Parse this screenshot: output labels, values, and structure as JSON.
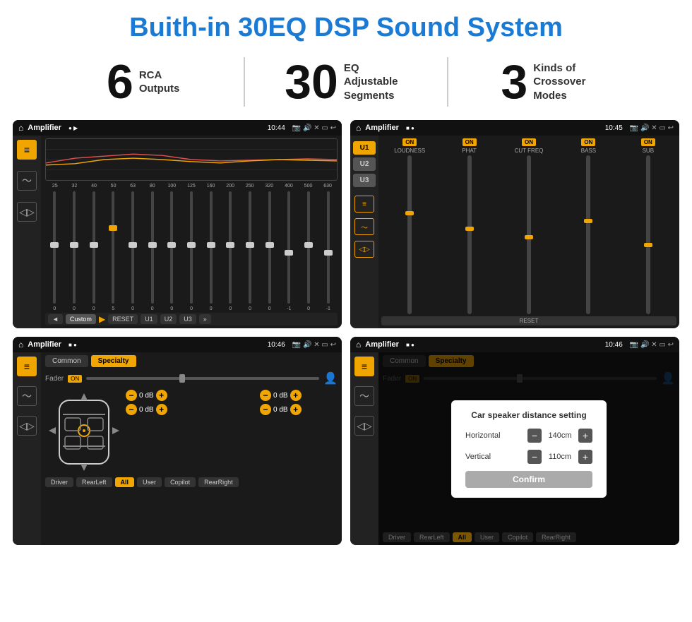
{
  "title": "Buith-in 30EQ DSP Sound System",
  "stats": [
    {
      "number": "6",
      "label": "RCA\nOutputs"
    },
    {
      "number": "30",
      "label": "EQ Adjustable\nSegments"
    },
    {
      "number": "3",
      "label": "Kinds of\nCrossover Modes"
    }
  ],
  "screens": [
    {
      "id": "screen1",
      "statusBar": {
        "appTitle": "Amplifier",
        "time": "10:44"
      },
      "eqFreqs": [
        "25",
        "32",
        "40",
        "50",
        "63",
        "80",
        "100",
        "125",
        "160",
        "200",
        "250",
        "320",
        "400",
        "500",
        "630"
      ],
      "eqVals": [
        "0",
        "0",
        "0",
        "5",
        "0",
        "0",
        "0",
        "0",
        "0",
        "0",
        "0",
        "0",
        "-1",
        "0",
        "-1"
      ],
      "eqThumbPositions": [
        50,
        50,
        50,
        35,
        50,
        50,
        50,
        50,
        50,
        50,
        50,
        50,
        58,
        50,
        58
      ],
      "bottomBtns": [
        "Custom",
        "RESET",
        "U1",
        "U2",
        "U3"
      ]
    },
    {
      "id": "screen2",
      "statusBar": {
        "appTitle": "Amplifier",
        "time": "10:45"
      },
      "uButtons": [
        "U1",
        "U2",
        "U3"
      ],
      "controls": [
        {
          "label": "LOUDNESS",
          "on": true,
          "thumbPct": 60
        },
        {
          "label": "PHAT",
          "on": true,
          "thumbPct": 40
        },
        {
          "label": "CUT FREQ",
          "on": true,
          "thumbPct": 50
        },
        {
          "label": "BASS",
          "on": true,
          "thumbPct": 55
        },
        {
          "label": "SUB",
          "on": true,
          "thumbPct": 45
        }
      ]
    },
    {
      "id": "screen3",
      "statusBar": {
        "appTitle": "Amplifier",
        "time": "10:46"
      },
      "tabs": [
        "Common",
        "Specialty"
      ],
      "activeTab": 1,
      "faderLabel": "Fader",
      "faderOn": true,
      "positions": [
        {
          "label": "Driver",
          "db": "0 dB",
          "side": "left"
        },
        {
          "label": "Copilot",
          "db": "0 dB",
          "side": "right"
        },
        {
          "label": "",
          "db": "0 dB",
          "side": "left"
        },
        {
          "label": "",
          "db": "0 dB",
          "side": "right"
        }
      ],
      "bottomBtns": [
        "Driver",
        "RearLeft",
        "All",
        "User",
        "Copilot",
        "RearRight"
      ]
    },
    {
      "id": "screen4",
      "statusBar": {
        "appTitle": "Amplifier",
        "time": "10:46"
      },
      "tabs": [
        "Common",
        "Specialty"
      ],
      "activeTab": 0,
      "dialog": {
        "title": "Car speaker distance setting",
        "horizontal": {
          "label": "Horizontal",
          "value": "140cm"
        },
        "vertical": {
          "label": "Vertical",
          "value": "110cm"
        },
        "confirmBtn": "Confirm"
      },
      "bottomBtns": [
        "Driver",
        "RearLeft",
        "All",
        "User",
        "Copilot",
        "RearRight"
      ]
    }
  ]
}
